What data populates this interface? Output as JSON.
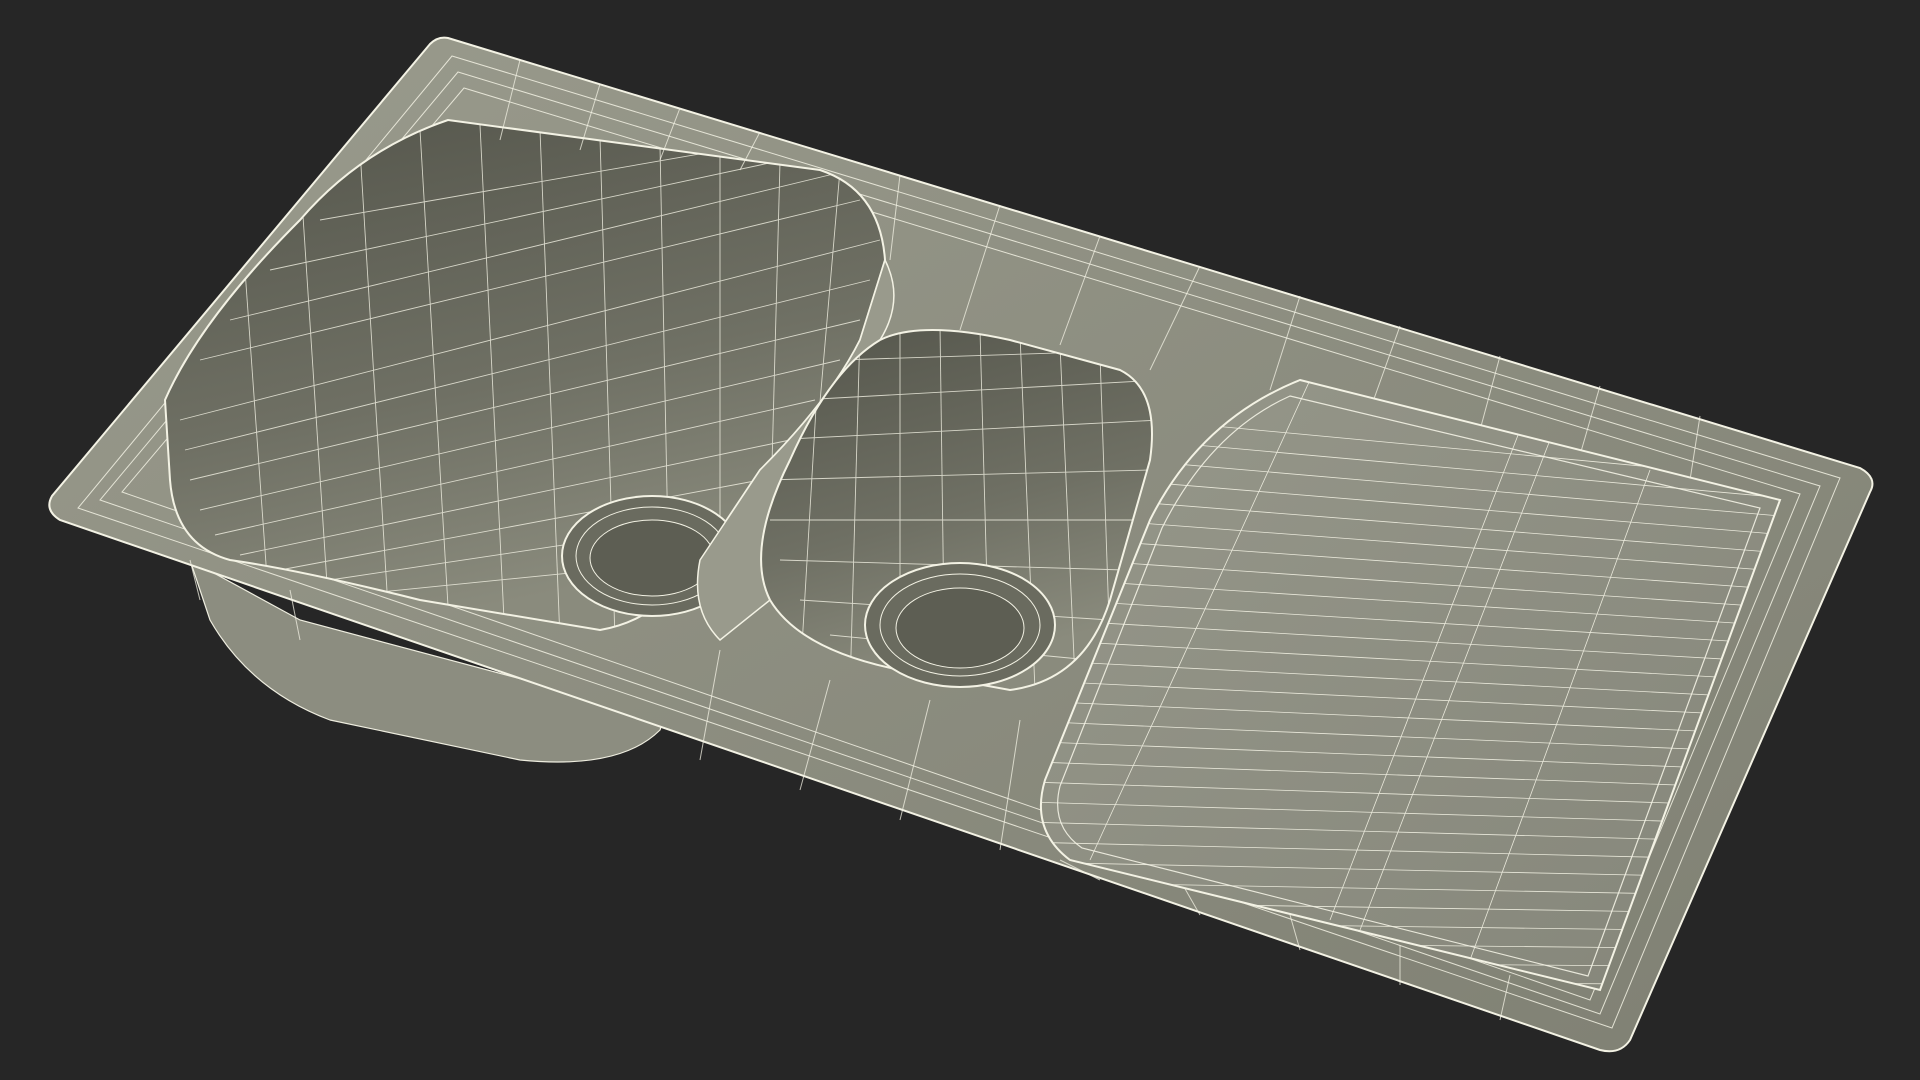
{
  "viewport": {
    "background_color": "#262626"
  },
  "model": {
    "subject": "kitchen sink",
    "display_mode": "wireframe",
    "surface_color": "#8d8e80",
    "shadow_color": "#5f6054",
    "wire_color": "#f3f2e4",
    "features": [
      "rim",
      "large-basin",
      "large-basin-drain",
      "small-basin",
      "small-basin-drain",
      "drainboard-with-ridges"
    ]
  }
}
